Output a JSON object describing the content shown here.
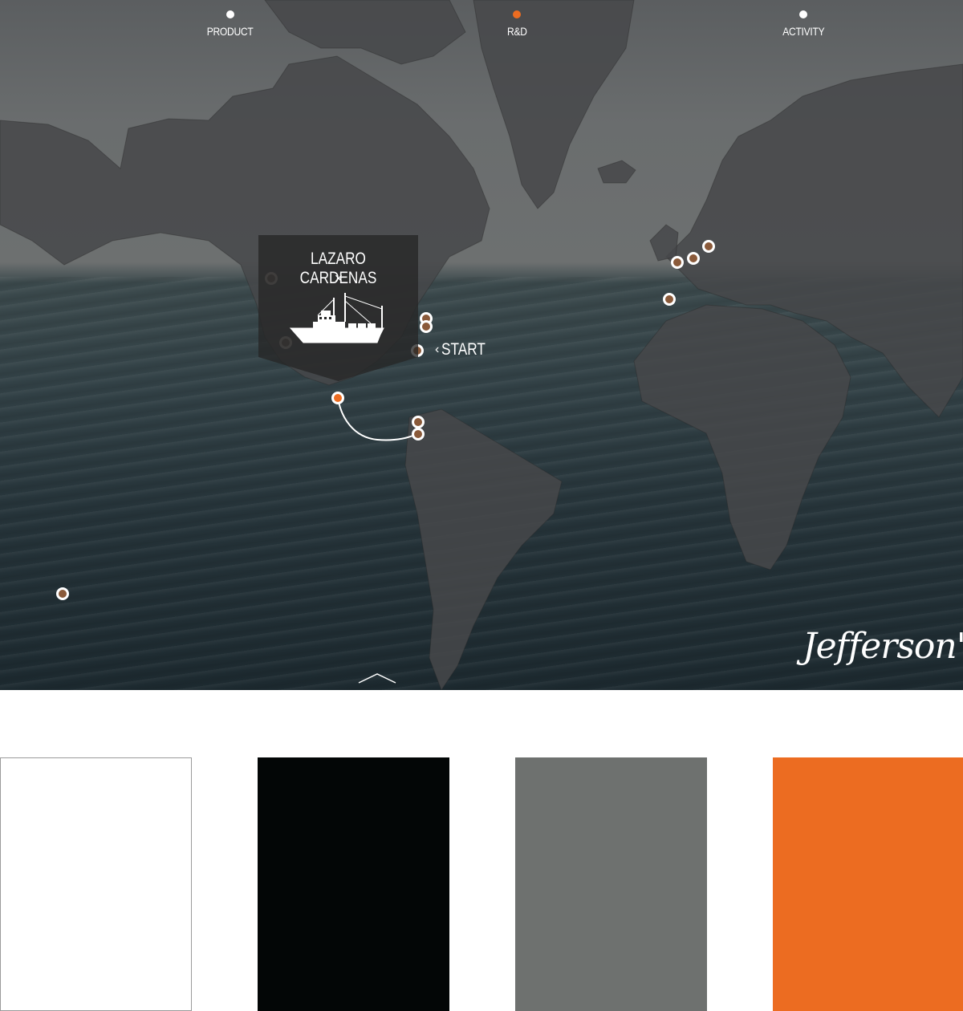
{
  "nav": {
    "items": [
      {
        "label": "PRODUCT",
        "active": false
      },
      {
        "label": "R&D",
        "active": true
      },
      {
        "label": "ACTIVITY",
        "active": false
      }
    ]
  },
  "popup": {
    "title": "LAZARO CARDENAS",
    "close_glyph": "×",
    "icon": "ship-icon"
  },
  "start": {
    "chevron": "‹",
    "label": "START"
  },
  "brand": {
    "logo_text": "Jefferson's"
  },
  "palette": {
    "swatches": [
      {
        "name": "white",
        "color": "#ffffff"
      },
      {
        "name": "black",
        "color": "#030606"
      },
      {
        "name": "gray",
        "color": "#6e716f"
      },
      {
        "name": "orange",
        "color": "#ec6c21"
      }
    ]
  },
  "colors": {
    "accent": "#ec6c21",
    "popup_bg": "rgba(40,40,40,0.75)",
    "text": "#ffffff"
  }
}
